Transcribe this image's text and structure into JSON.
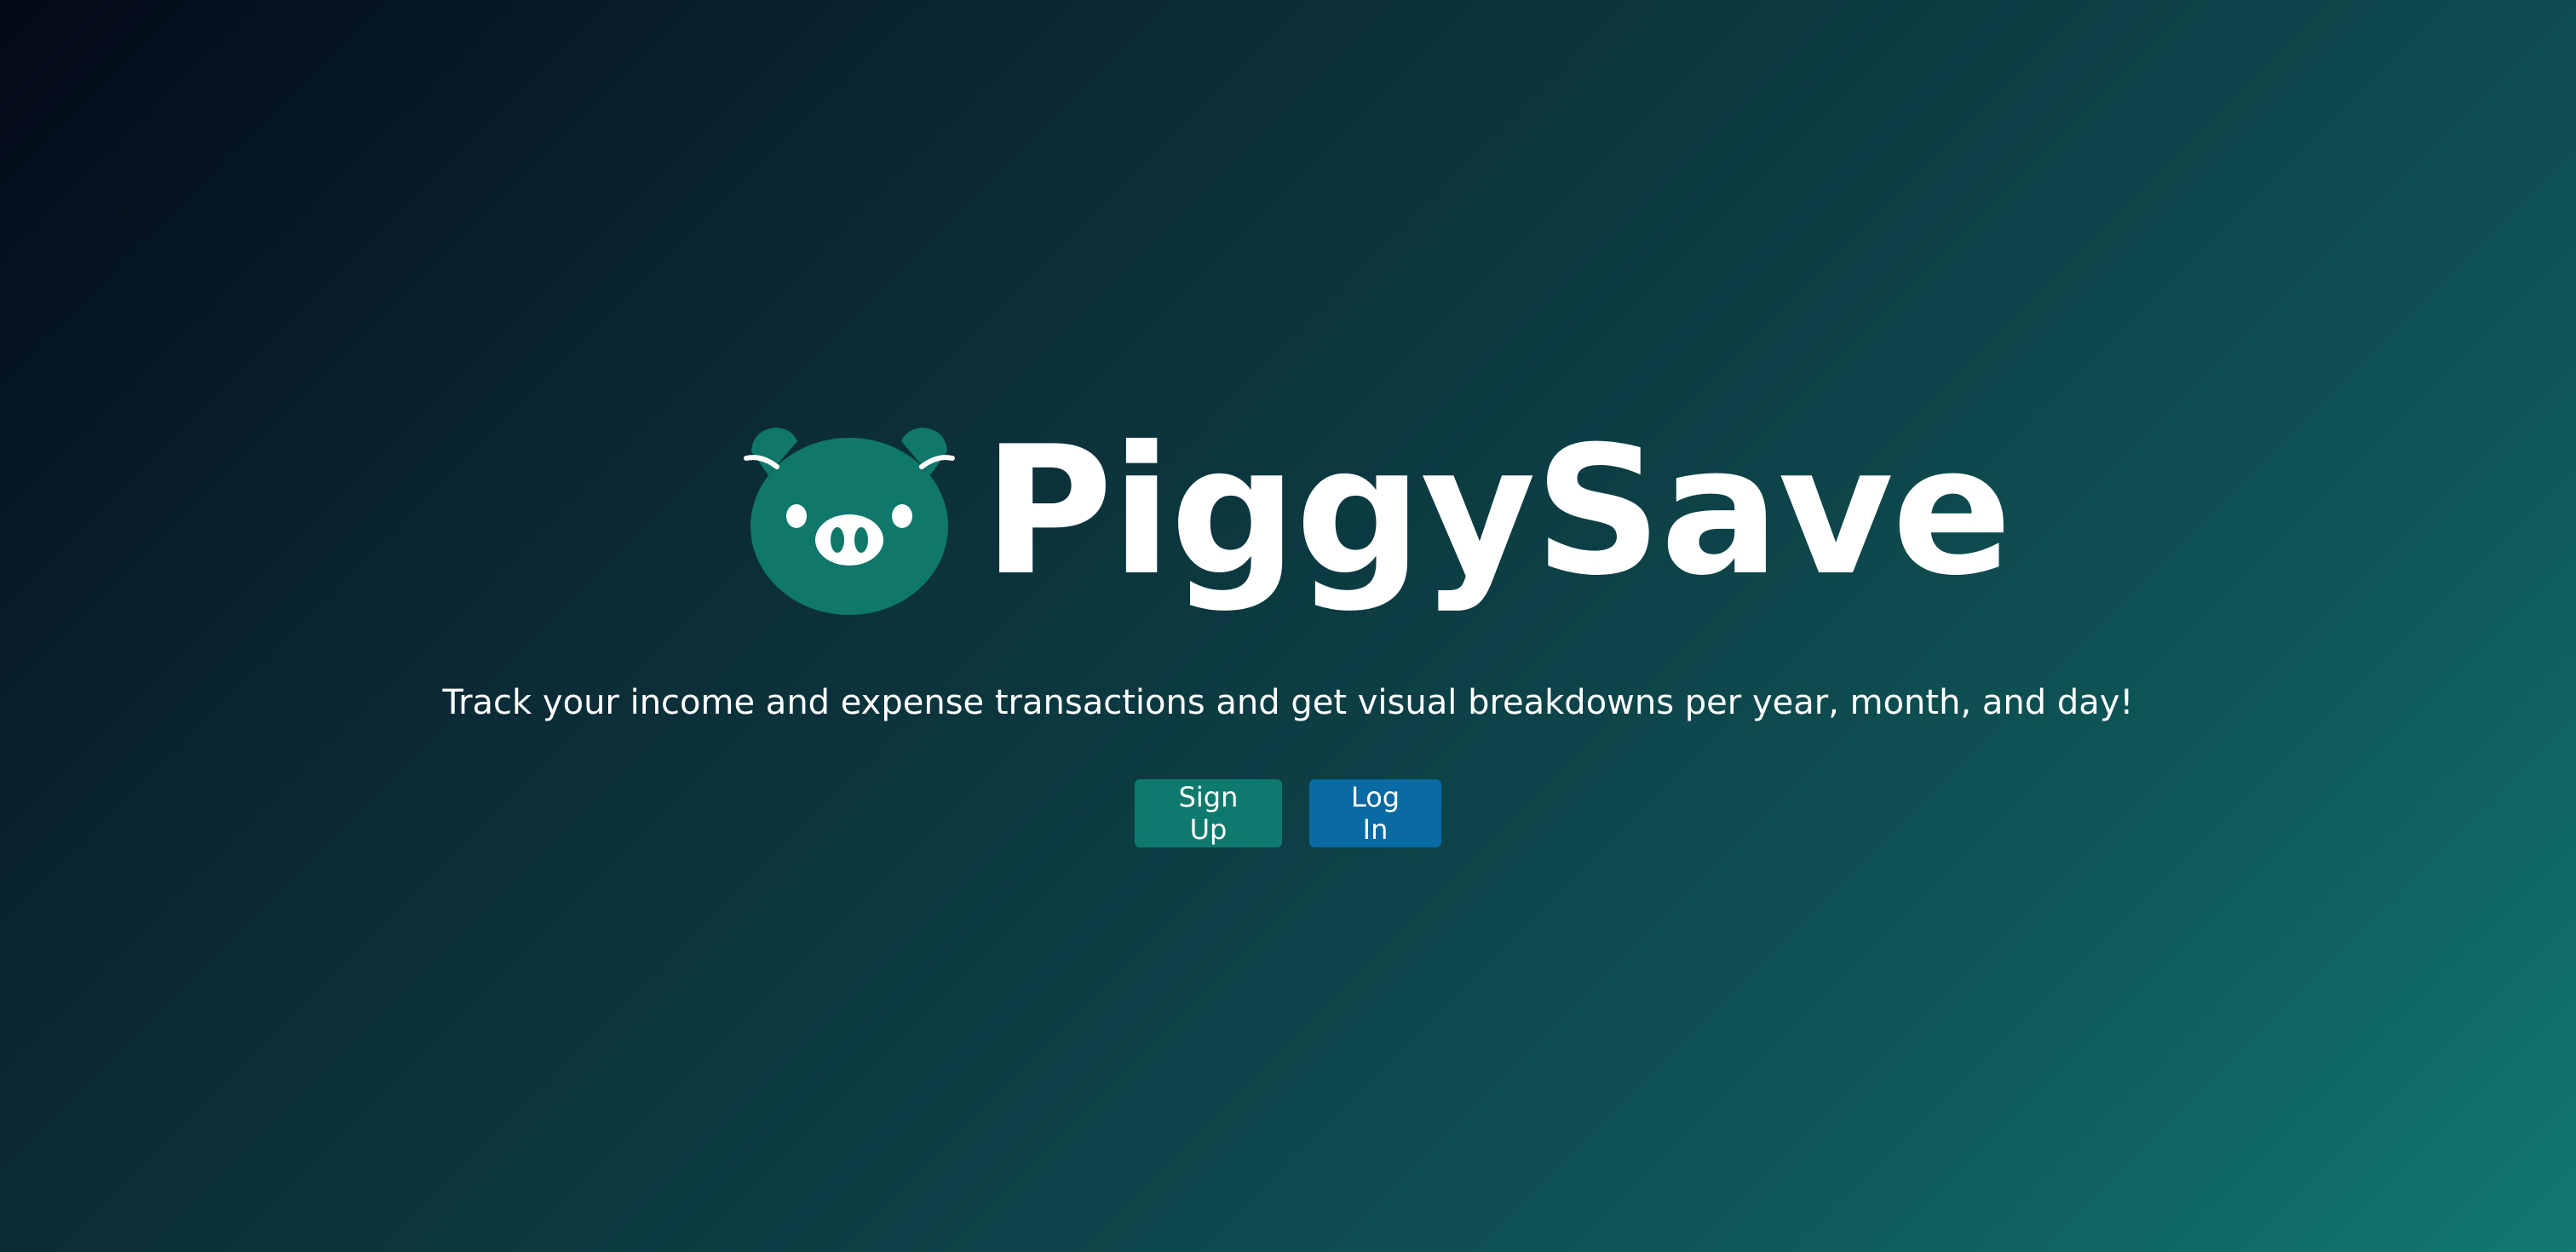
{
  "brand": {
    "name": "PiggySave",
    "logo_icon": "pig-face-icon",
    "logo_color": "#10776b"
  },
  "hero": {
    "tagline": "Track your income and expense transactions and get visual breakdowns per year, month, and day!"
  },
  "actions": {
    "signup_label": "Sign Up",
    "login_label": "Log In",
    "signup_color": "#0e7a6d",
    "login_color": "#0a6aa3"
  }
}
